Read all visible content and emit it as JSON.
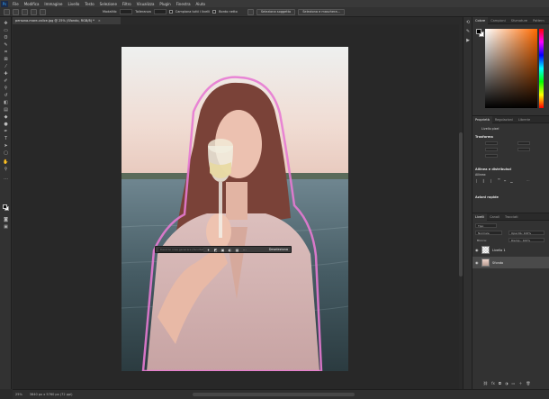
{
  "menubar": {
    "logo": "Ps",
    "items": [
      "File",
      "Modifica",
      "Immagine",
      "Livello",
      "Testo",
      "Selezione",
      "Filtro",
      "Visualizza",
      "Plugin",
      "Finestra",
      "Aiuto"
    ]
  },
  "options_bar": {
    "sample_label": "Modalità:",
    "tolerance_label": "Tolleranza",
    "sample_all_label": "Campiona tutti i livelli",
    "smooth_label": "Bordo netto",
    "select_subject_label": "Seleziona soggetto",
    "select_mask_label": "Seleziona e maschera..."
  },
  "document": {
    "tab_title": "persona-mare-calice.jpg @ 25% (Sfondo, RGB/8) *",
    "close_glyph": "×"
  },
  "context_bar": {
    "prompt_placeholder": "Descrivi cosa generare (facoltativo)",
    "action_label": "Deseleziona"
  },
  "statusbar": {
    "zoom": "25%",
    "doc_size": "3840 px x 5760 px (72 ppi)"
  },
  "color_panel": {
    "tabs": [
      "Colore",
      "Campioni",
      "Sfumature",
      "Pattern"
    ],
    "foreground": "#000000",
    "background": "#ffffff"
  },
  "properties_panel": {
    "tabs": [
      "Proprietà",
      "Regolazioni",
      "Librerie"
    ],
    "layer_type": "Livello pixel",
    "transform_header": "Trasforma",
    "align_header": "Allinea e distribuisci",
    "align_sub": "Allinea:",
    "quick_actions_header": "Azioni rapide"
  },
  "layers_panel": {
    "tabs": [
      "Livelli",
      "Canali",
      "Tracciati"
    ],
    "filter_label": "Tipo",
    "blend_mode": "Normale",
    "opacity_label": "Opacità: 100%",
    "lock_label": "Blocca:",
    "fill_label": "Riemp.: 100%",
    "layers": [
      {
        "name": "Livello 1",
        "type": "transparent",
        "selected": false
      },
      {
        "name": "Sfondo",
        "type": "photo",
        "selected": true
      }
    ]
  },
  "accent": "#e77ad3"
}
